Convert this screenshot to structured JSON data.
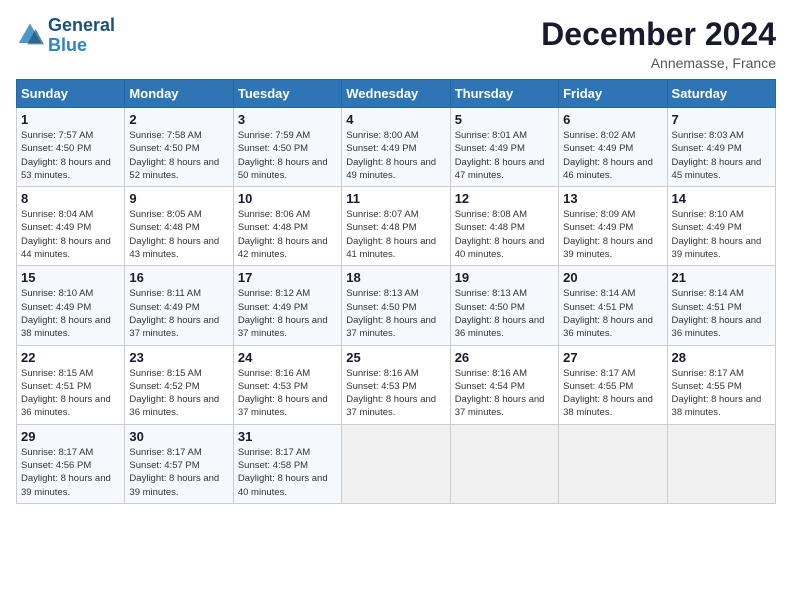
{
  "header": {
    "logo_line1": "General",
    "logo_line2": "Blue",
    "month_title": "December 2024",
    "location": "Annemasse, France"
  },
  "columns": [
    "Sunday",
    "Monday",
    "Tuesday",
    "Wednesday",
    "Thursday",
    "Friday",
    "Saturday"
  ],
  "weeks": [
    [
      {
        "day": "1",
        "sunrise": "Sunrise: 7:57 AM",
        "sunset": "Sunset: 4:50 PM",
        "daylight": "Daylight: 8 hours and 53 minutes."
      },
      {
        "day": "2",
        "sunrise": "Sunrise: 7:58 AM",
        "sunset": "Sunset: 4:50 PM",
        "daylight": "Daylight: 8 hours and 52 minutes."
      },
      {
        "day": "3",
        "sunrise": "Sunrise: 7:59 AM",
        "sunset": "Sunset: 4:50 PM",
        "daylight": "Daylight: 8 hours and 50 minutes."
      },
      {
        "day": "4",
        "sunrise": "Sunrise: 8:00 AM",
        "sunset": "Sunset: 4:49 PM",
        "daylight": "Daylight: 8 hours and 49 minutes."
      },
      {
        "day": "5",
        "sunrise": "Sunrise: 8:01 AM",
        "sunset": "Sunset: 4:49 PM",
        "daylight": "Daylight: 8 hours and 47 minutes."
      },
      {
        "day": "6",
        "sunrise": "Sunrise: 8:02 AM",
        "sunset": "Sunset: 4:49 PM",
        "daylight": "Daylight: 8 hours and 46 minutes."
      },
      {
        "day": "7",
        "sunrise": "Sunrise: 8:03 AM",
        "sunset": "Sunset: 4:49 PM",
        "daylight": "Daylight: 8 hours and 45 minutes."
      }
    ],
    [
      {
        "day": "8",
        "sunrise": "Sunrise: 8:04 AM",
        "sunset": "Sunset: 4:49 PM",
        "daylight": "Daylight: 8 hours and 44 minutes."
      },
      {
        "day": "9",
        "sunrise": "Sunrise: 8:05 AM",
        "sunset": "Sunset: 4:48 PM",
        "daylight": "Daylight: 8 hours and 43 minutes."
      },
      {
        "day": "10",
        "sunrise": "Sunrise: 8:06 AM",
        "sunset": "Sunset: 4:48 PM",
        "daylight": "Daylight: 8 hours and 42 minutes."
      },
      {
        "day": "11",
        "sunrise": "Sunrise: 8:07 AM",
        "sunset": "Sunset: 4:48 PM",
        "daylight": "Daylight: 8 hours and 41 minutes."
      },
      {
        "day": "12",
        "sunrise": "Sunrise: 8:08 AM",
        "sunset": "Sunset: 4:48 PM",
        "daylight": "Daylight: 8 hours and 40 minutes."
      },
      {
        "day": "13",
        "sunrise": "Sunrise: 8:09 AM",
        "sunset": "Sunset: 4:49 PM",
        "daylight": "Daylight: 8 hours and 39 minutes."
      },
      {
        "day": "14",
        "sunrise": "Sunrise: 8:10 AM",
        "sunset": "Sunset: 4:49 PM",
        "daylight": "Daylight: 8 hours and 39 minutes."
      }
    ],
    [
      {
        "day": "15",
        "sunrise": "Sunrise: 8:10 AM",
        "sunset": "Sunset: 4:49 PM",
        "daylight": "Daylight: 8 hours and 38 minutes."
      },
      {
        "day": "16",
        "sunrise": "Sunrise: 8:11 AM",
        "sunset": "Sunset: 4:49 PM",
        "daylight": "Daylight: 8 hours and 37 minutes."
      },
      {
        "day": "17",
        "sunrise": "Sunrise: 8:12 AM",
        "sunset": "Sunset: 4:49 PM",
        "daylight": "Daylight: 8 hours and 37 minutes."
      },
      {
        "day": "18",
        "sunrise": "Sunrise: 8:13 AM",
        "sunset": "Sunset: 4:50 PM",
        "daylight": "Daylight: 8 hours and 37 minutes."
      },
      {
        "day": "19",
        "sunrise": "Sunrise: 8:13 AM",
        "sunset": "Sunset: 4:50 PM",
        "daylight": "Daylight: 8 hours and 36 minutes."
      },
      {
        "day": "20",
        "sunrise": "Sunrise: 8:14 AM",
        "sunset": "Sunset: 4:51 PM",
        "daylight": "Daylight: 8 hours and 36 minutes."
      },
      {
        "day": "21",
        "sunrise": "Sunrise: 8:14 AM",
        "sunset": "Sunset: 4:51 PM",
        "daylight": "Daylight: 8 hours and 36 minutes."
      }
    ],
    [
      {
        "day": "22",
        "sunrise": "Sunrise: 8:15 AM",
        "sunset": "Sunset: 4:51 PM",
        "daylight": "Daylight: 8 hours and 36 minutes."
      },
      {
        "day": "23",
        "sunrise": "Sunrise: 8:15 AM",
        "sunset": "Sunset: 4:52 PM",
        "daylight": "Daylight: 8 hours and 36 minutes."
      },
      {
        "day": "24",
        "sunrise": "Sunrise: 8:16 AM",
        "sunset": "Sunset: 4:53 PM",
        "daylight": "Daylight: 8 hours and 37 minutes."
      },
      {
        "day": "25",
        "sunrise": "Sunrise: 8:16 AM",
        "sunset": "Sunset: 4:53 PM",
        "daylight": "Daylight: 8 hours and 37 minutes."
      },
      {
        "day": "26",
        "sunrise": "Sunrise: 8:16 AM",
        "sunset": "Sunset: 4:54 PM",
        "daylight": "Daylight: 8 hours and 37 minutes."
      },
      {
        "day": "27",
        "sunrise": "Sunrise: 8:17 AM",
        "sunset": "Sunset: 4:55 PM",
        "daylight": "Daylight: 8 hours and 38 minutes."
      },
      {
        "day": "28",
        "sunrise": "Sunrise: 8:17 AM",
        "sunset": "Sunset: 4:55 PM",
        "daylight": "Daylight: 8 hours and 38 minutes."
      }
    ],
    [
      {
        "day": "29",
        "sunrise": "Sunrise: 8:17 AM",
        "sunset": "Sunset: 4:56 PM",
        "daylight": "Daylight: 8 hours and 39 minutes."
      },
      {
        "day": "30",
        "sunrise": "Sunrise: 8:17 AM",
        "sunset": "Sunset: 4:57 PM",
        "daylight": "Daylight: 8 hours and 39 minutes."
      },
      {
        "day": "31",
        "sunrise": "Sunrise: 8:17 AM",
        "sunset": "Sunset: 4:58 PM",
        "daylight": "Daylight: 8 hours and 40 minutes."
      },
      null,
      null,
      null,
      null
    ]
  ]
}
